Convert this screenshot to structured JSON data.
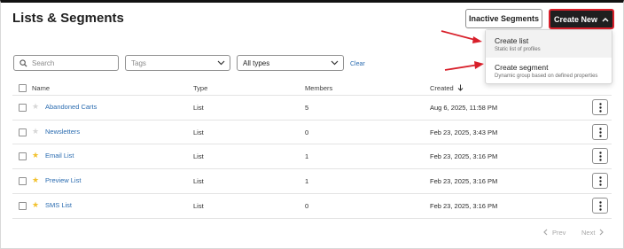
{
  "header": {
    "title": "Lists & Segments",
    "inactive_button": "Inactive Segments",
    "create_button": "Create New"
  },
  "create_menu": {
    "items": [
      {
        "title": "Create list",
        "subtitle": "Static list of profiles"
      },
      {
        "title": "Create segment",
        "subtitle": "Dynamic group based on defined properties"
      }
    ]
  },
  "filters": {
    "search_placeholder": "Search",
    "tags_placeholder": "Tags",
    "type_value": "All types",
    "clear_label": "Clear"
  },
  "table": {
    "columns": [
      "Name",
      "Type",
      "Members",
      "Created"
    ],
    "rows": [
      {
        "name": "Abandoned Carts",
        "starred": false,
        "type": "List",
        "members": "5",
        "created": "Aug 6, 2025, 11:58 PM"
      },
      {
        "name": "Newsletters",
        "starred": false,
        "type": "List",
        "members": "0",
        "created": "Feb 23, 2025, 3:43 PM"
      },
      {
        "name": "Email List",
        "starred": true,
        "type": "List",
        "members": "1",
        "created": "Feb 23, 2025, 3:16 PM"
      },
      {
        "name": "Preview List",
        "starred": true,
        "type": "List",
        "members": "1",
        "created": "Feb 23, 2025, 3:16 PM"
      },
      {
        "name": "SMS List",
        "starred": true,
        "type": "List",
        "members": "0",
        "created": "Feb 23, 2025, 3:16 PM"
      }
    ]
  },
  "pagination": {
    "prev_label": "Prev",
    "next_label": "Next"
  },
  "colors": {
    "accent_red": "#d81f2a",
    "link_blue": "#2b6cb0",
    "star_gold": "#f2c12e",
    "dark_button": "#1f1f1f"
  }
}
